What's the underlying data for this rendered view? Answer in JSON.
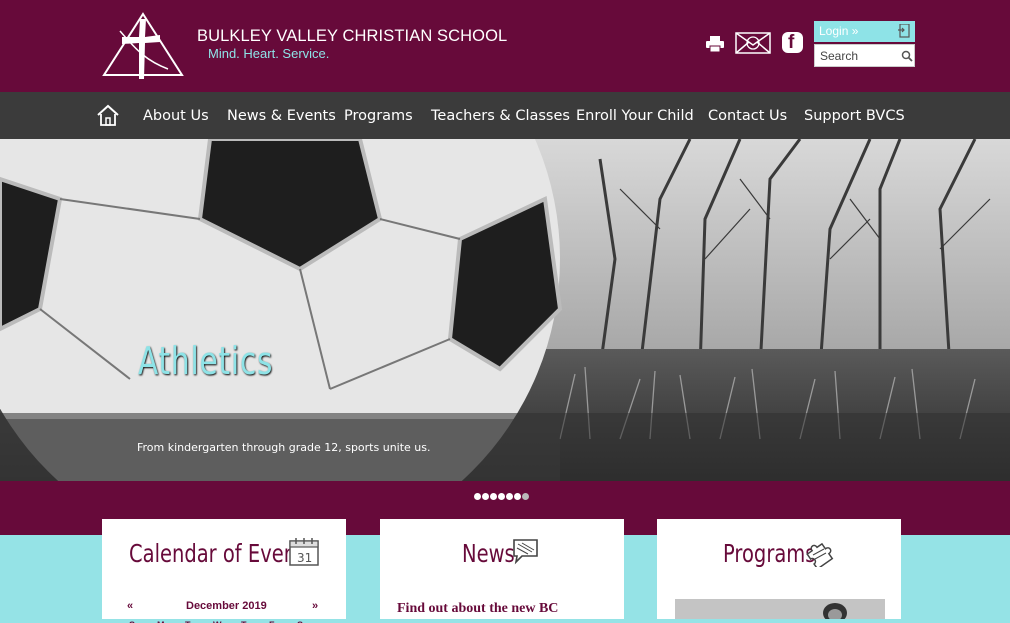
{
  "header": {
    "school_name": "BULKLEY VALLEY CHRISTIAN SCHOOL",
    "tagline": "Mind. Heart. Service.",
    "login_label": "Login »",
    "search_placeholder": "Search",
    "social": {
      "facebook_glyph": "f"
    }
  },
  "nav": {
    "items": [
      {
        "label": "About Us"
      },
      {
        "label": "News & Events"
      },
      {
        "label": "Programs"
      },
      {
        "label": "Teachers & Classes"
      },
      {
        "label": "Enroll Your Child"
      },
      {
        "label": "Contact Us"
      },
      {
        "label": "Support BVCS"
      }
    ]
  },
  "hero": {
    "title": "Athletics",
    "caption": "From kindergarten through grade 12, sports unite us.",
    "slide_count": 7,
    "active_slide": 6
  },
  "cards": {
    "calendar": {
      "title": "Calendar of Events",
      "icon_day": "31",
      "prev": "«",
      "next": "»",
      "month": "December 2019",
      "weekdays": [
        "S",
        "M",
        "T",
        "W",
        "T",
        "F",
        "S"
      ]
    },
    "news": {
      "title": "News",
      "headline": "Find out about the new BC"
    },
    "programs": {
      "title": "Programs"
    }
  },
  "colors": {
    "brand_maroon": "#670a3a",
    "accent_aqua": "#8ee3e7",
    "nav_gray": "#3b3b3b",
    "page_aqua": "#95e3e6"
  },
  "icons": [
    "logo-cross-icon",
    "print-icon",
    "mail-icon",
    "facebook-icon",
    "login-icon",
    "search-icon",
    "home-icon",
    "calendar-icon",
    "speech-bubble-icon",
    "puzzle-icon"
  ]
}
